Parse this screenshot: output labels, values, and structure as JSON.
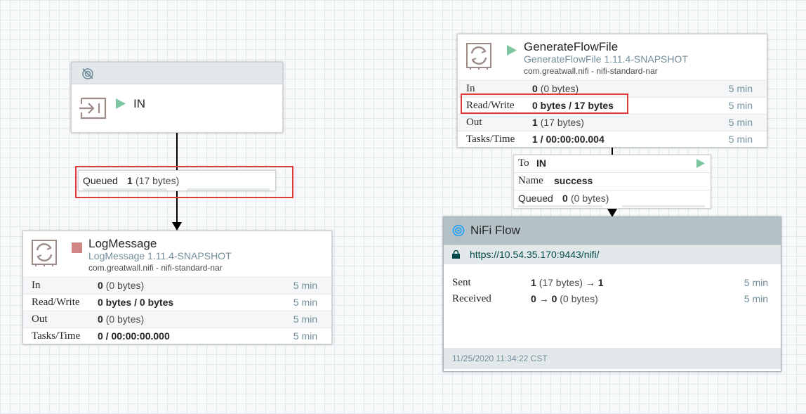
{
  "input_port": {
    "name": "IN"
  },
  "connection_left": {
    "queued_label": "Queued",
    "queued_count": "1",
    "queued_size": "(17 bytes)"
  },
  "log_message": {
    "name": "LogMessage",
    "type": "LogMessage 1.11.4-SNAPSHOT",
    "bundle": "com.greatwall.nifi - nifi-standard-nar",
    "stats": {
      "in_label": "In",
      "in_bold": "0",
      "in_plain": "(0 bytes)",
      "in_time": "5 min",
      "rw_label": "Read/Write",
      "rw_value": "0 bytes / 0 bytes",
      "rw_time": "5 min",
      "out_label": "Out",
      "out_bold": "0",
      "out_plain": "(0 bytes)",
      "out_time": "5 min",
      "tasks_label": "Tasks/Time",
      "tasks_value": "0 / 00:00:00.000",
      "tasks_time": "5 min"
    }
  },
  "generate_flowfile": {
    "name": "GenerateFlowFile",
    "type": "GenerateFlowFile 1.11.4-SNAPSHOT",
    "bundle": "com.greatwall.nifi - nifi-standard-nar",
    "stats": {
      "in_label": "In",
      "in_bold": "0",
      "in_plain": "(0 bytes)",
      "in_time": "5 min",
      "rw_label": "Read/Write",
      "rw_value": "0 bytes / 17 bytes",
      "rw_time": "5 min",
      "out_label": "Out",
      "out_bold": "1",
      "out_plain": "(17 bytes)",
      "out_time": "5 min",
      "tasks_label": "Tasks/Time",
      "tasks_value": "1 / 00:00:00.004",
      "tasks_time": "5 min"
    }
  },
  "connection_right": {
    "to_label": "To",
    "to_value": "IN",
    "name_label": "Name",
    "name_value": "success",
    "queued_label": "Queued",
    "queued_count": "0",
    "queued_size": "(0 bytes)"
  },
  "remote_group": {
    "name": "NiFi Flow",
    "url": "https://10.54.35.170:9443/nifi/",
    "sent_label": "Sent",
    "sent_bold": "1",
    "sent_plain": "(17 bytes)",
    "sent_arrow": "→",
    "sent_after": "1",
    "sent_time": "5 min",
    "received_label": "Received",
    "received_bold": "0",
    "received_arrow": "→",
    "received_after": "0",
    "received_plain": "(0 bytes)",
    "received_time": "5 min",
    "timestamp": "11/25/2020 11:34:22 CST"
  },
  "colors": {
    "accent": "#728e9b",
    "highlight": "#e03a3a",
    "running": "#7dc7a0",
    "stopped": "#d18686"
  }
}
